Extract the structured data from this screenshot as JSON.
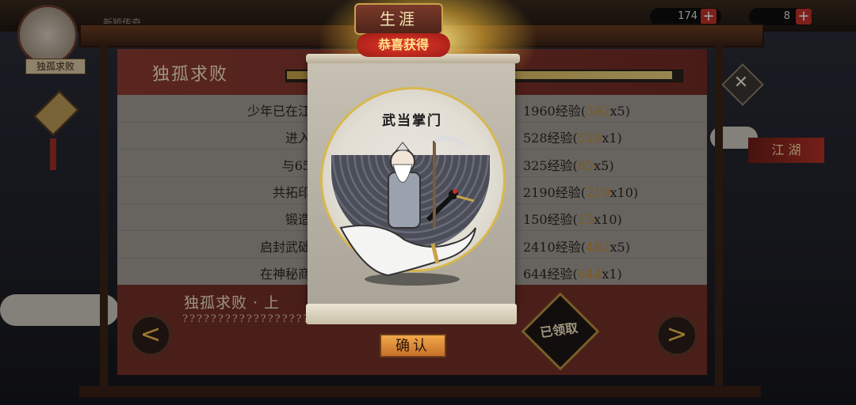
{
  "topbar": {
    "scrolling_text": "新颖传奇",
    "resource_1": "174",
    "resource_2": "8",
    "plus": "+"
  },
  "player": {
    "name": "独孤求败"
  },
  "side": {
    "jianghu_label": "江 湖"
  },
  "panel": {
    "title": "独孤求败",
    "progress_fraction": 0.98,
    "tasks": [
      {
        "label": "少年已在江",
        "reward": "1960经验(",
        "mult": "392",
        "suffix": "x5)"
      },
      {
        "label": "进入",
        "reward": "528经验(",
        "mult": "528",
        "suffix": "x1)"
      },
      {
        "label": "与65",
        "reward": "325经验(",
        "mult": "65",
        "suffix": "x5)"
      },
      {
        "label": "共拓印",
        "reward": "2190经验(",
        "mult": "219",
        "suffix": "x10)"
      },
      {
        "label": "锻造",
        "reward": "150经验(",
        "mult": "15",
        "suffix": "x10)"
      },
      {
        "label": "启封武础",
        "reward": "2410经验(",
        "mult": "482",
        "suffix": "x5)"
      },
      {
        "label": "在神秘商",
        "reward": "644经验(",
        "mult": "644",
        "suffix": "x1)"
      }
    ],
    "chapter_title": "独孤求败 · 上",
    "chapter_desc": "???????????????????????",
    "claimed_badge": "已领取",
    "prev": "<",
    "next": ">",
    "close": "✕"
  },
  "popup": {
    "title_tab": "生涯",
    "banner": "恭喜获得",
    "portrait_name": "武当掌门",
    "confirm": "确认"
  },
  "colors": {
    "accent_gold": "#d7b84d",
    "multiplier": "#c78a2a",
    "panel_red": "#6f3028"
  }
}
